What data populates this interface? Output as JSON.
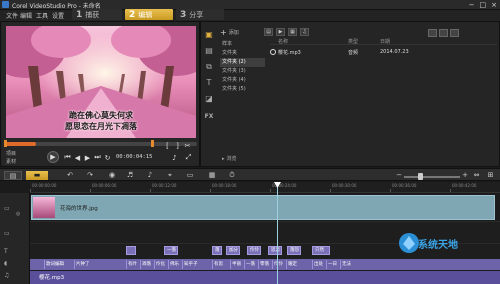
{
  "window": {
    "title": "Corel VideoStudio Pro - 未命名"
  },
  "menu": {
    "items": [
      "文件",
      "编辑",
      "工具",
      "设置"
    ]
  },
  "steps": [
    {
      "num": "1",
      "label": "捕获"
    },
    {
      "num": "2",
      "label": "编辑"
    },
    {
      "num": "3",
      "label": "分享"
    }
  ],
  "preview": {
    "subtitle_line1": "跪在佛心莫失何求",
    "subtitle_line2": "愿思恋在月光下凋落",
    "modes": [
      "项目",
      "素材"
    ],
    "timecode": "00:00:04:15"
  },
  "library": {
    "add_label": "添加",
    "folders": [
      "样本",
      "文件夹",
      "文件夹 (2)",
      "文件夹 (3)",
      "文件夹 (4)",
      "文件夹 (5)"
    ],
    "columns": [
      "名称",
      "类型",
      "日期",
      ""
    ],
    "files": [
      {
        "name": "樱花.mp3",
        "type": "音频",
        "date": "2014.07.23",
        "extra": ""
      }
    ],
    "browse_label": "浏览"
  },
  "timeline": {
    "ruler_labels": [
      "00:00:00:00",
      "00:00:06:00",
      "00:00:12:00",
      "00:00:18:00",
      "00:00:24:00",
      "00:00:30:00",
      "00:00:36:00",
      "00:00:42:00"
    ],
    "video_clip_name": "花海的世界.jpg",
    "title_clips": [
      "",
      "一落",
      "落",
      "加分",
      "伶伶",
      "落怨",
      "思恋",
      "只然"
    ],
    "subtitle_segments": [
      "歌词编辑",
      "片钟了",
      "有叶",
      "凋落",
      "伶化",
      "佛乐",
      "知乎子",
      "有思",
      "半丽",
      "一落",
      "零落",
      "伶伶",
      "耀定",
      "出处",
      "一日",
      "无法"
    ],
    "music_clip_name": "樱花.mp3"
  },
  "watermark": {
    "text": "系统天地"
  },
  "colors": {
    "accent": "#d8a93a",
    "video_clip": "#7fa6b3",
    "title_clip": "#7a70b8",
    "music_clip": "#5a4f9a"
  }
}
